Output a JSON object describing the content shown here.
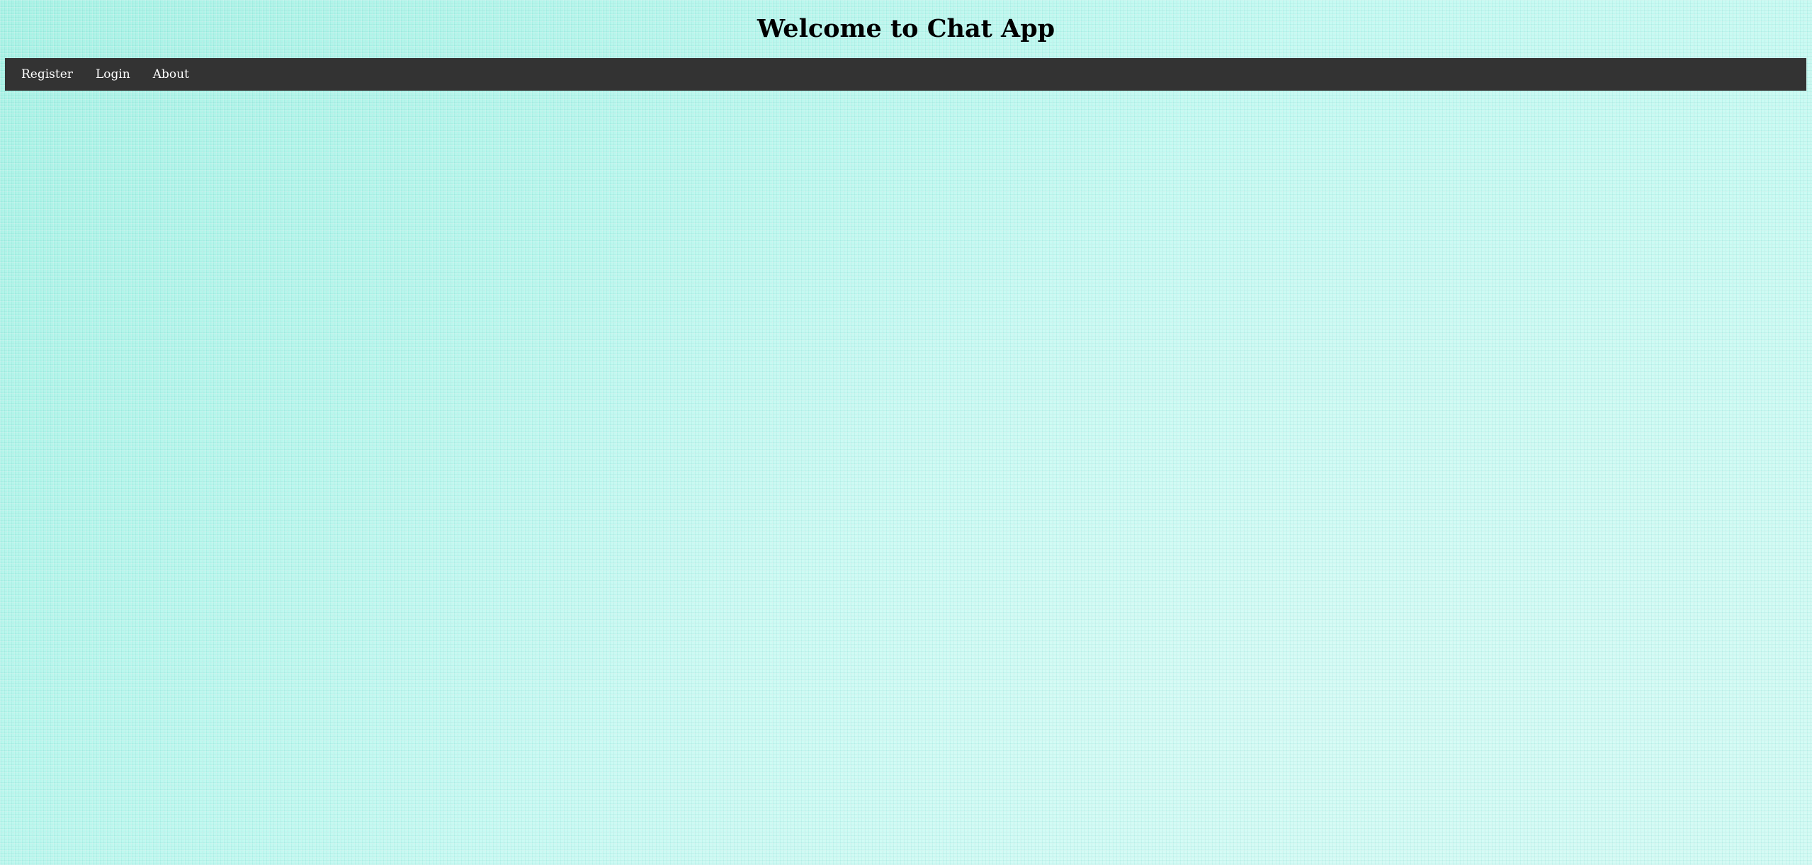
{
  "header": {
    "title": "Welcome to Chat App"
  },
  "nav": {
    "items": [
      {
        "label": "Register"
      },
      {
        "label": "Login"
      },
      {
        "label": "About"
      }
    ]
  },
  "colors": {
    "background": "#bdf7ee",
    "navbar": "#333333",
    "nav_text": "#ffffff",
    "title_text": "#000000"
  }
}
